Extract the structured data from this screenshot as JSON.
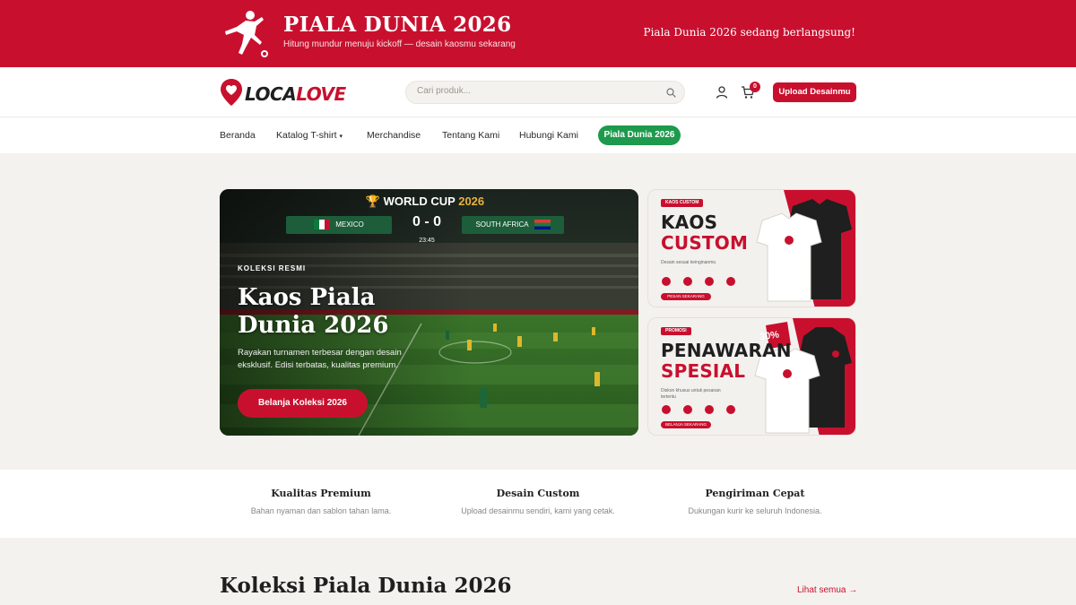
{
  "topbar": {
    "title": "PIALA DUNIA 2026",
    "subtitle": "Hitung mundur menuju kickoff — desain kaosmu sekarang",
    "live_text": "Piala Dunia 2026 sedang berlangsung!"
  },
  "header": {
    "brand_part1": "LOCA",
    "brand_part2": "LOVE",
    "search_placeholder": "Cari produk...",
    "cart_count": "0",
    "upload_label": "Upload Desainmu"
  },
  "nav": {
    "items": [
      "Beranda",
      "Katalog T-shirt",
      "Merchandise",
      "Tentang Kami",
      "Hubungi Kami"
    ],
    "highlight": "Piala Dunia 2026"
  },
  "hero": {
    "scoreboard_title": "WORLD CUP",
    "scoreboard_year": "2026",
    "team_home": "MEXICO",
    "team_away": "SOUTH AFRICA",
    "score": "0 - 0",
    "time": "23:45",
    "eyebrow": "KOLEKSI RESMI",
    "heading": "Kaos Piala Dunia 2026",
    "description": "Rayakan turnamen terbesar dengan desain eksklusif. Edisi terbatas, kualitas premium.",
    "cta": "Belanja Koleksi 2026"
  },
  "cards": [
    {
      "tag": "KAOS CUSTOM",
      "line1": "KAOS",
      "line2": "CUSTOM",
      "mini": "Desain sesuai keinginanmu",
      "button": "PESAN SEKARANG"
    },
    {
      "tag": "PROMOSI",
      "line1": "PENAWARAN",
      "line2": "SPESIAL",
      "mini": "Diskon khusus untuk pesanan tertentu",
      "button": "BELANJA SEKARANG",
      "discount": "30%"
    }
  ],
  "features": [
    {
      "title": "Kualitas Premium",
      "text": "Bahan nyaman dan sablon tahan lama."
    },
    {
      "title": "Desain Custom",
      "text": "Upload desainmu sendiri, kami yang cetak."
    },
    {
      "title": "Pengiriman Cepat",
      "text": "Dukungan kurir ke seluruh Indonesia."
    }
  ],
  "collection": {
    "title": "Koleksi Piala Dunia 2026",
    "see_all": "Lihat semua →"
  },
  "colors": {
    "brand_red": "#c8102e",
    "nav_green": "#1e9a4d",
    "page_bg": "#f4f2ee"
  }
}
